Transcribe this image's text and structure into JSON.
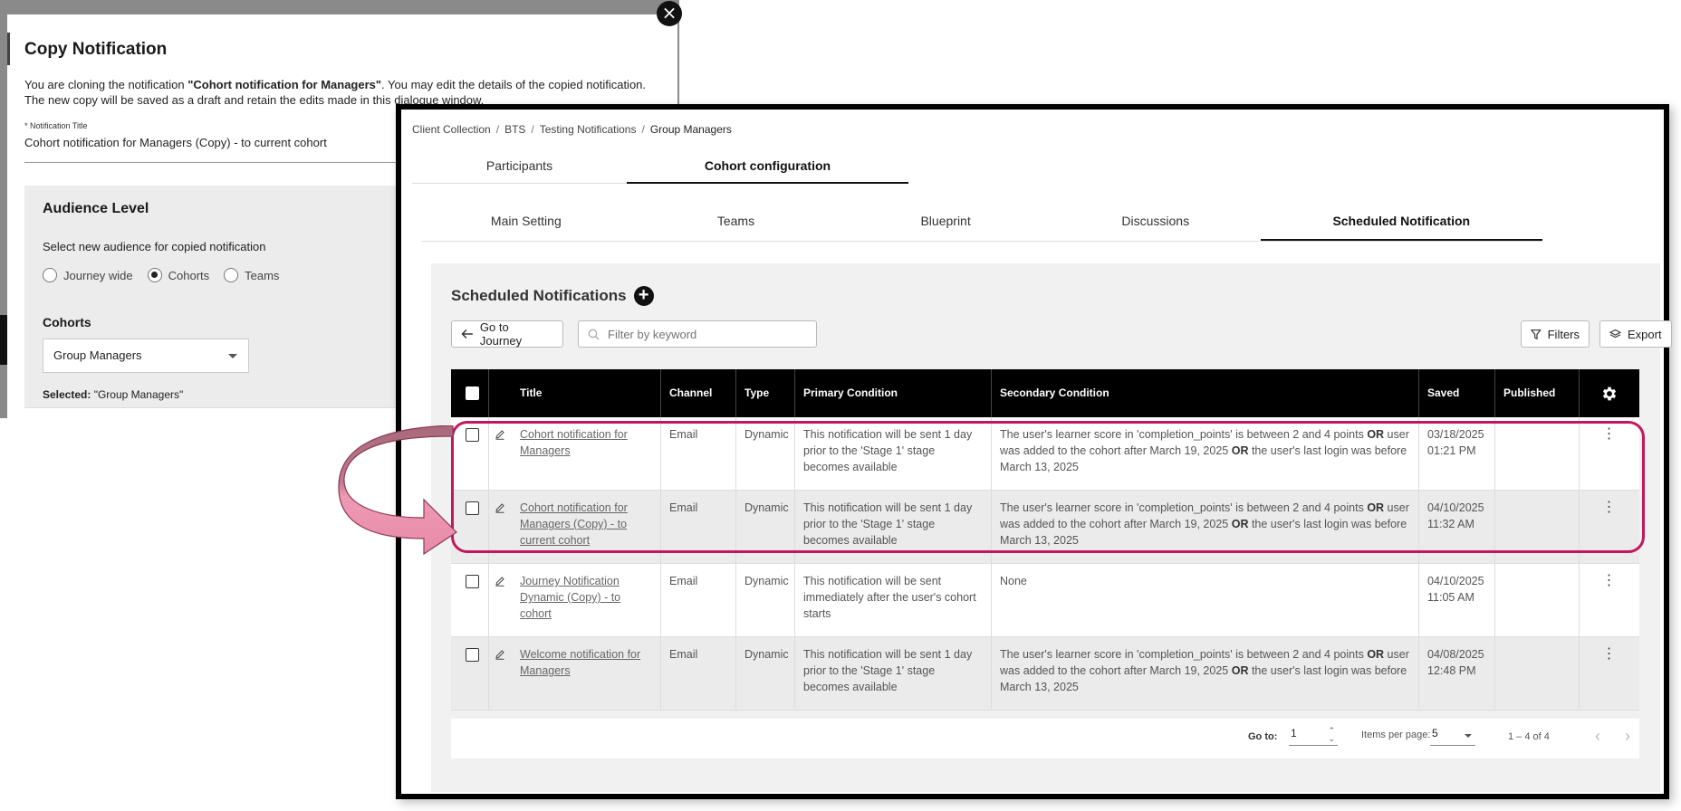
{
  "modal": {
    "title": "Copy Notification",
    "intro_prefix": "You are cloning the notification ",
    "intro_bold": "\"Cohort notification for Managers\"",
    "intro_suffix": ". You may edit the details of the copied notification.",
    "intro_line2": "The new copy will be saved as a draft and retain the edits made in this dialogue window.",
    "title_field_label": "* Notification Title",
    "title_field_value": "Cohort notification for Managers (Copy) - to current cohort",
    "audience_heading": "Audience Level",
    "select_audience_label": "Select new audience for copied notification",
    "radio_options": [
      "Journey wide",
      "Cohorts",
      "Teams"
    ],
    "radio_selected": "Cohorts",
    "cohorts_label": "Cohorts",
    "cohort_value": "Group Managers",
    "selected_label": "Selected:",
    "selected_value": " \"Group Managers\"",
    "close_glyph": "×"
  },
  "breadcrumb": [
    "Client Collection",
    "BTS",
    "Testing Notifications",
    "Group Managers"
  ],
  "breadcrumb_sep": "/",
  "top_tabs": [
    "Participants",
    "Cohort configuration"
  ],
  "top_tabs_active": "Cohort configuration",
  "sub_tabs": [
    "Main Setting",
    "Teams",
    "Blueprint",
    "Discussions",
    "Scheduled Notification"
  ],
  "sub_tabs_active": "Scheduled Notification",
  "section_title": "Scheduled Notifications",
  "toolbar": {
    "go_to_journey": "Go to Journey",
    "filter_placeholder": "Filter by keyword",
    "filters": "Filters",
    "export": "Export"
  },
  "table": {
    "columns": [
      "Title",
      "Channel",
      "Type",
      "Primary Condition",
      "Secondary Condition",
      "Saved",
      "Published"
    ],
    "rows": [
      {
        "title": "Cohort notification for Managers",
        "channel": "Email",
        "type": "Dynamic",
        "primary": "This notification will be sent 1 day prior to the 'Stage 1' stage becomes available",
        "secondary_a": "The user's learner score in 'completion_points' is between 2 and 4 points ",
        "secondary_b": " user was added to the cohort after March 19, 2025 ",
        "secondary_c": " the user's last login was before March 13, 2025",
        "or": "OR",
        "saved_date": "03/18/2025",
        "saved_time": "01:21 PM",
        "published": ""
      },
      {
        "title": "Cohort notification for Managers (Copy) - to current cohort",
        "channel": "Email",
        "type": "Dynamic",
        "primary": "This notification will be sent 1 day prior to the 'Stage 1' stage becomes available",
        "secondary_a": "The user's learner score in 'completion_points' is between 2 and 4 points ",
        "secondary_b": " user was added to the cohort after March 19, 2025 ",
        "secondary_c": " the user's last login was before March 13, 2025",
        "or": "OR",
        "saved_date": "04/10/2025",
        "saved_time": "11:32 AM",
        "published": ""
      },
      {
        "title": "Journey Notification Dynamic (Copy) - to cohort",
        "channel": "Email",
        "type": "Dynamic",
        "primary": "This notification will be sent immediately after the user's cohort starts",
        "secondary_plain": "None",
        "saved_date": "04/10/2025",
        "saved_time": "11:05 AM",
        "published": ""
      },
      {
        "title": "Welcome notification for Managers",
        "channel": "Email",
        "type": "Dynamic",
        "primary": "This notification will be sent 1 day prior to the 'Stage 1' stage becomes available",
        "secondary_a": "The user's learner score in 'completion_points' is between 2 and 4 points ",
        "secondary_b": " user was added to the cohort after March 19, 2025 ",
        "secondary_c": " the user's last login was before March 13, 2025",
        "or": "OR",
        "saved_date": "04/08/2025",
        "saved_time": "12:48 PM",
        "published": ""
      }
    ]
  },
  "pagination": {
    "go_to_label": "Go to:",
    "go_to_value": "1",
    "items_per_page_label": "Items per page:",
    "items_per_page_value": "5",
    "range": "1 – 4 of 4",
    "prev": "‹",
    "next": "›"
  },
  "icons": {
    "close": "close-icon",
    "plus": "plus-icon",
    "arrow_left": "arrow-left-icon",
    "search": "search-icon",
    "filter": "filter-icon",
    "export": "layers-icon",
    "gear": "gear-icon",
    "edit": "pencil-icon",
    "kebab": "kebab-menu-icon"
  },
  "colors": {
    "highlight": "#c2185b",
    "arrow_fill": "#e68aa6",
    "header_bg": "#000000",
    "panel_bg": "#f1f1f1"
  }
}
